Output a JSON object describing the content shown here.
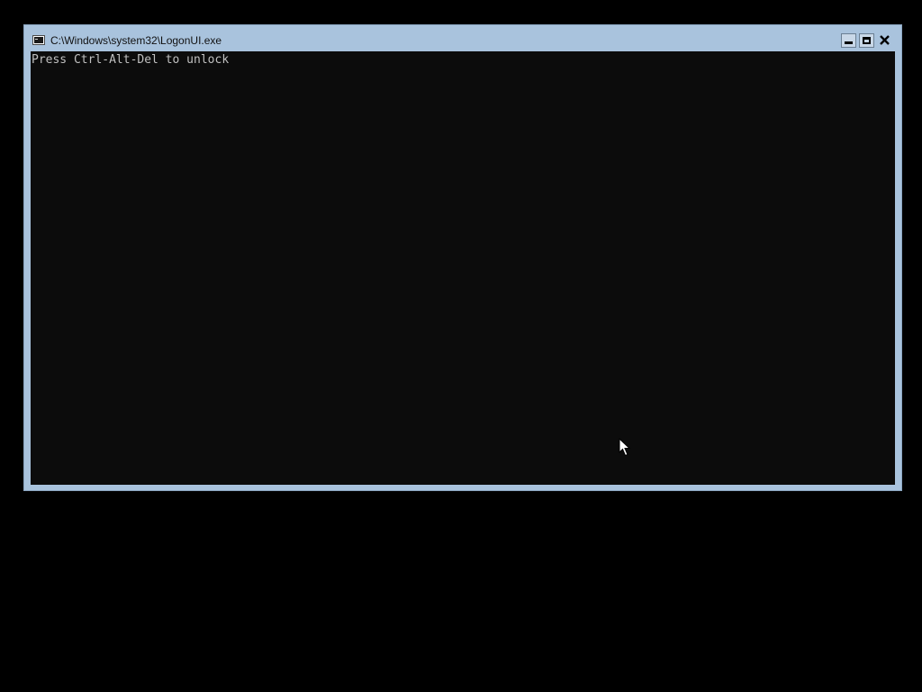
{
  "window": {
    "title": "C:\\Windows\\system32\\LogonUI.exe",
    "icon": "console-window-icon",
    "controls": {
      "minimize": "minimize-icon",
      "maximize": "maximize-icon",
      "close": "close-icon"
    }
  },
  "console": {
    "lines": [
      "Press Ctrl-Alt-Del to unlock"
    ]
  },
  "colors": {
    "desktop_bg": "#000000",
    "window_frame": "#a9c3dd",
    "console_bg": "#0c0c0c",
    "console_text": "#c0c0c0"
  }
}
